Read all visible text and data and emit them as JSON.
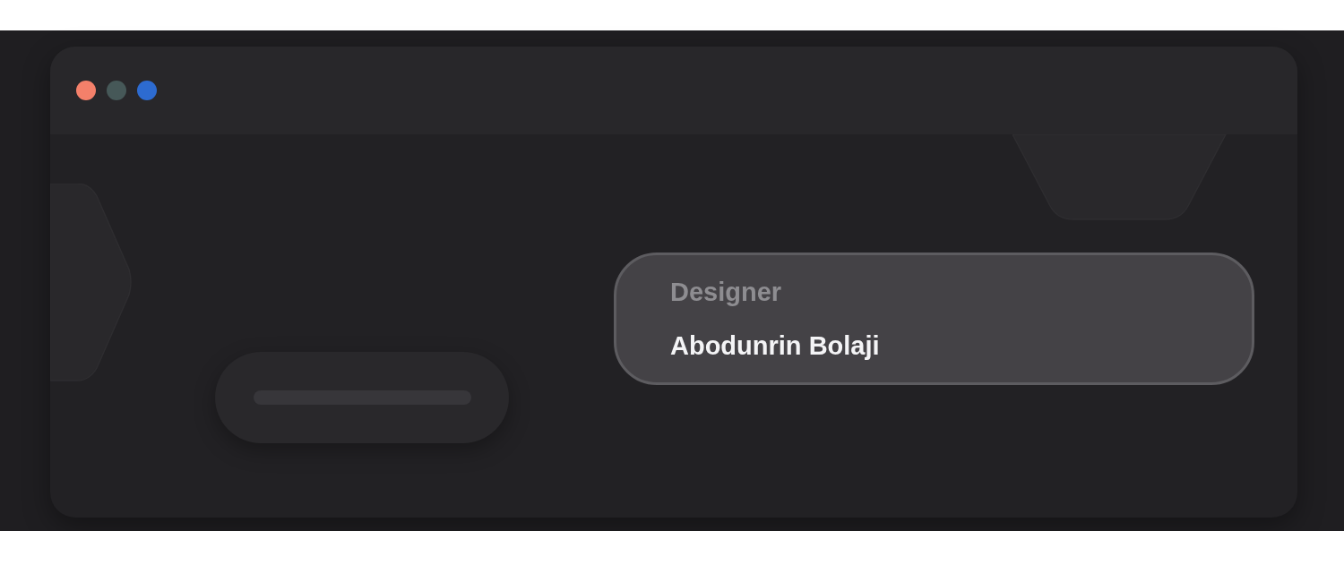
{
  "window": {
    "controls": [
      {
        "color": "#f4806a"
      },
      {
        "color": "#465858"
      },
      {
        "color": "#2d6bd0"
      }
    ]
  },
  "profile_card": {
    "role": "Designer",
    "name": "Abodunrin Bolaji"
  }
}
